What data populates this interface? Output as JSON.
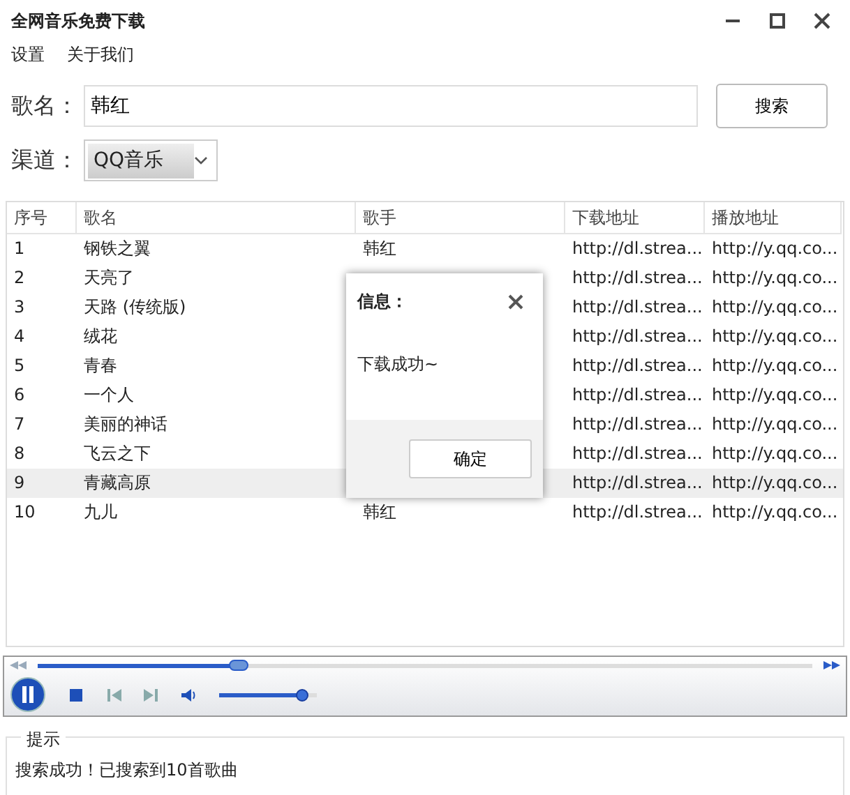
{
  "window": {
    "title": "全网音乐免费下载"
  },
  "menu": [
    "设置",
    "关于我们"
  ],
  "search": {
    "label": "歌名：",
    "value": "韩红",
    "button": "搜索"
  },
  "channel": {
    "label": "渠道：",
    "value": "QQ音乐"
  },
  "table": {
    "columns": [
      "序号",
      "歌名",
      "歌手",
      "下载地址",
      "播放地址"
    ],
    "rows": [
      {
        "index": "1",
        "song": "钢铁之翼",
        "singer": "韩红",
        "download": "http://dl.strea...",
        "play": "http://y.qq.co...",
        "selected": false
      },
      {
        "index": "2",
        "song": "天亮了",
        "download": "http://dl.strea...",
        "play": "http://y.qq.co...",
        "selected": false
      },
      {
        "index": "3",
        "song": "天路 (传统版)",
        "download": "http://dl.strea...",
        "play": "http://y.qq.co...",
        "selected": false
      },
      {
        "index": "4",
        "song": "绒花",
        "download": "http://dl.strea...",
        "play": "http://y.qq.co...",
        "selected": false
      },
      {
        "index": "5",
        "song": "青春",
        "download": "http://dl.strea...",
        "play": "http://y.qq.co...",
        "selected": false
      },
      {
        "index": "6",
        "song": "一个人",
        "download": "http://dl.strea...",
        "play": "http://y.qq.co...",
        "selected": false
      },
      {
        "index": "7",
        "song": "美丽的神话",
        "download": "http://dl.strea...",
        "play": "http://y.qq.co...",
        "selected": false
      },
      {
        "index": "8",
        "song": "飞云之下",
        "download": "http://dl.strea...",
        "play": "http://y.qq.co...",
        "selected": false
      },
      {
        "index": "9",
        "song": "青藏高原",
        "download": "http://dl.strea...",
        "play": "http://y.qq.co...",
        "selected": true
      },
      {
        "index": "10",
        "song": "九儿",
        "singer": "韩红",
        "download": "http://dl.strea...",
        "play": "http://y.qq.co...",
        "selected": false
      }
    ]
  },
  "dialog": {
    "title": "信息：",
    "message": "下载成功~",
    "button": "确定"
  },
  "player": {
    "playing": true,
    "progress": {
      "level": 0.26
    },
    "volume": {
      "level": 0.85
    }
  },
  "hint": {
    "title": "提示",
    "message": "搜索成功！已搜索到10首歌曲"
  }
}
